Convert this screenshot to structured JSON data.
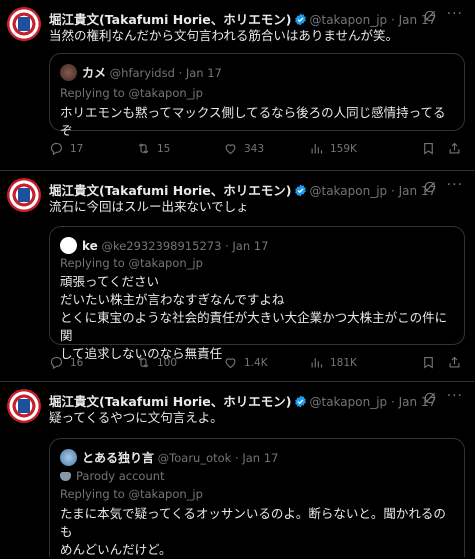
{
  "tweets": [
    {
      "author": {
        "name": "堀江貴文(Takafumi Horie、ホリエモン)",
        "handle": "@takapon_jp",
        "date": "Jan 17"
      },
      "text": "当然の権利なんだから文句言われる筋合いはありませんが笑。",
      "quote": {
        "name": "カメ",
        "handle": "@hfaryidsd",
        "date": "Jan 17",
        "replying": "Replying to @takapon_jp",
        "lines": [
          "ホリエモンも黙ってマックス側してるなら後ろの人同じ感情持ってるぞ"
        ]
      },
      "stats": {
        "replies": "17",
        "reposts": "15",
        "likes": "343",
        "views": "159K"
      }
    },
    {
      "author": {
        "name": "堀江貴文(Takafumi Horie、ホリエモン)",
        "handle": "@takapon_jp",
        "date": "Jan 17"
      },
      "text": "流石に今回はスルー出来ないでしょ",
      "quote": {
        "name": "ke",
        "handle": "@ke2932398915273",
        "date": "Jan 17",
        "replying": "Replying to @takapon_jp",
        "lines": [
          "頑張ってください",
          "だいたい株主が言わなすぎなんですよね",
          "とくに東宝のような社会的責任が大きい大企業かつ大株主がこの件に関",
          "して追求しないのなら無責任"
        ]
      },
      "stats": {
        "replies": "16",
        "reposts": "100",
        "likes": "1.4K",
        "views": "181K"
      }
    },
    {
      "author": {
        "name": "堀江貴文(Takafumi Horie、ホリエモン)",
        "handle": "@takapon_jp",
        "date": "Jan 17"
      },
      "text": "疑ってくるやつに文句言えよ。",
      "quote": {
        "name": "とある独り言",
        "handle": "@Toaru_otok",
        "date": "Jan 17",
        "parody": "Parody account",
        "replying": "Replying to @takapon_jp",
        "lines": [
          "たまに本気で疑ってくるオッサンいるのよ。断らないと。聞かれるのも",
          "めんどいんだけど。"
        ]
      }
    }
  ],
  "colors": {
    "background": "#000000",
    "text": "#e7e9ea",
    "muted": "#71767b",
    "verified": "#1d9bf0",
    "border": "#2f3336"
  },
  "icons": [
    "verified-badge-icon",
    "grok-icon",
    "more-icon",
    "reply-icon",
    "repost-icon",
    "like-icon",
    "views-icon",
    "bookmark-icon",
    "share-icon",
    "parody-mask-icon"
  ]
}
